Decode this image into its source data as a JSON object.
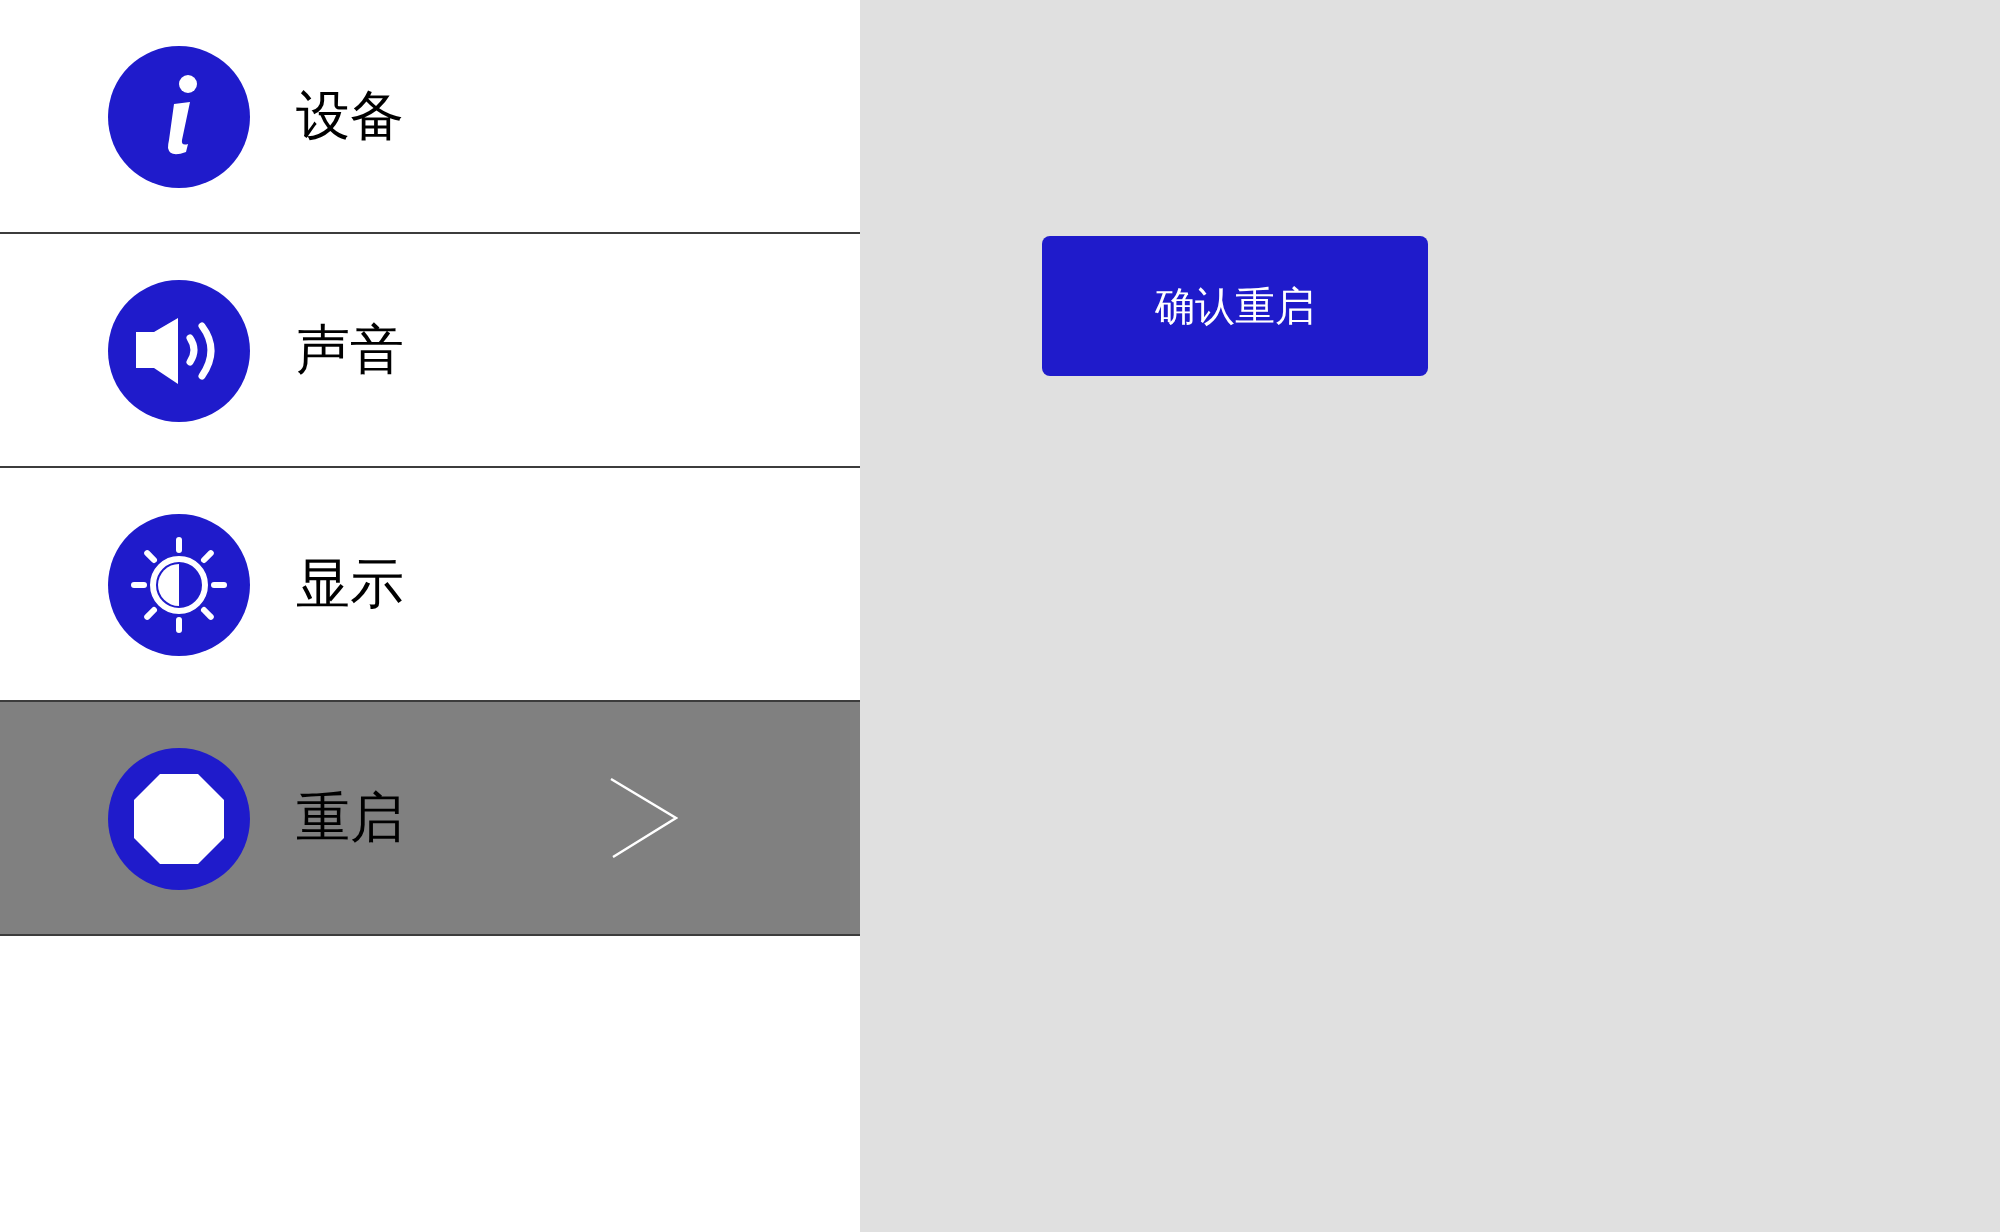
{
  "menu": {
    "items": [
      {
        "kind": "info",
        "label": "设备",
        "selected": false
      },
      {
        "kind": "sound",
        "label": "声音",
        "selected": false
      },
      {
        "kind": "display",
        "label": "显示",
        "selected": false
      },
      {
        "kind": "power",
        "label": "重启",
        "selected": true
      }
    ]
  },
  "confirm_button": {
    "label": "确认重启"
  }
}
